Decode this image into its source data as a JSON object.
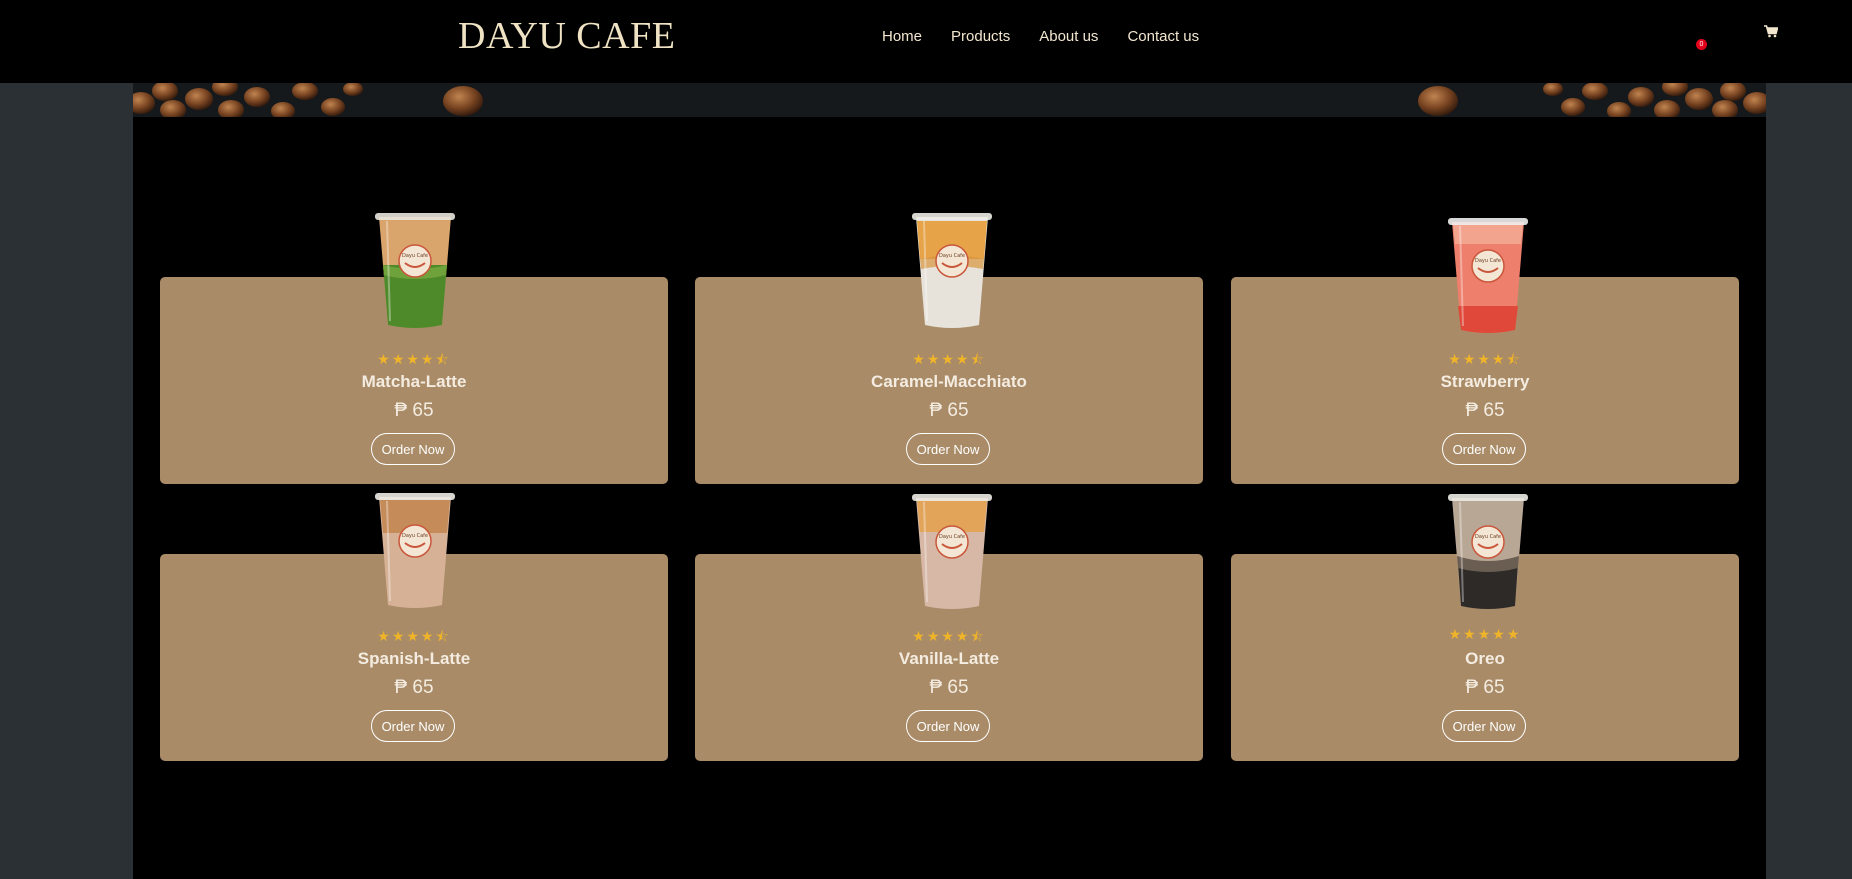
{
  "brand": {
    "name": "DAYU CAFE"
  },
  "nav": {
    "items": [
      {
        "label": "Home"
      },
      {
        "label": "Products"
      },
      {
        "label": "About us"
      },
      {
        "label": "Contact us"
      }
    ]
  },
  "cart": {
    "count": "0",
    "icon": "cart-icon"
  },
  "products": [
    {
      "name": "Matcha-Latte",
      "price": "₱ 65",
      "stars": "★★★★⯪",
      "rating": 4.5,
      "button": "Order Now"
    },
    {
      "name": "Caramel-Macchiato",
      "price": "₱ 65",
      "stars": "★★★★⯪",
      "rating": 4.5,
      "button": "Order Now"
    },
    {
      "name": "Strawberry",
      "price": "₱ 65",
      "stars": "★★★★⯪",
      "rating": 4.5,
      "button": "Order Now"
    },
    {
      "name": "Spanish-Latte",
      "price": "₱ 65",
      "stars": "★★★★⯪",
      "rating": 4.5,
      "button": "Order Now"
    },
    {
      "name": "Vanilla-Latte",
      "price": "₱ 65",
      "stars": "★★★★⯪",
      "rating": 4.5,
      "button": "Order Now"
    },
    {
      "name": "Oreo",
      "price": "₱ 65",
      "stars": "★★★★★",
      "rating": 5,
      "button": "Order Now"
    }
  ],
  "colors": {
    "navbar_bg": "#000000",
    "page_bg": "#2b3034",
    "card_bg": "#a98b67",
    "star": "#f0b429",
    "brand_text": "#efe3c4",
    "badge": "#e2001a"
  }
}
